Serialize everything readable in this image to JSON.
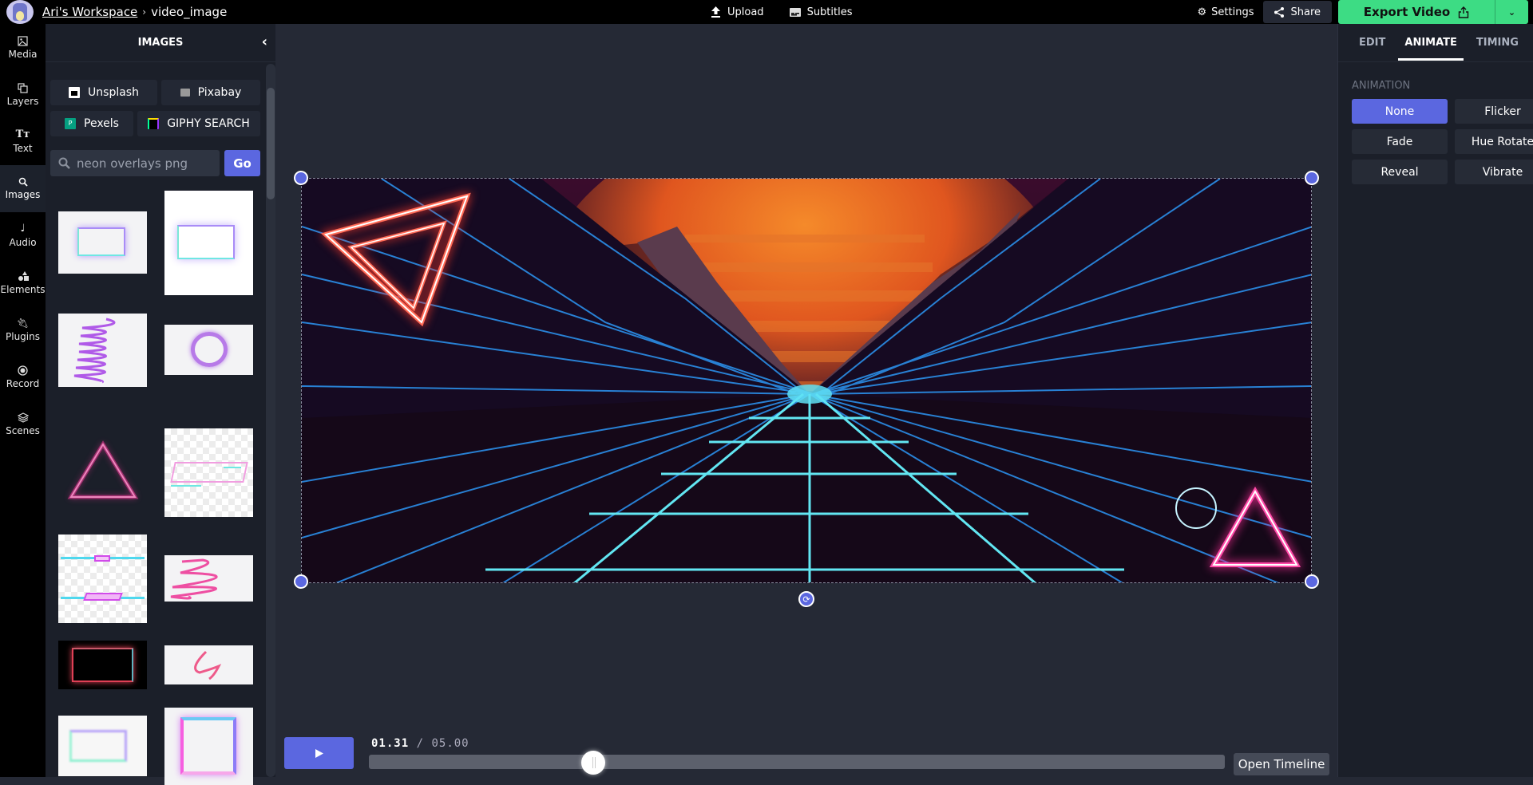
{
  "header": {
    "workspace": "Ari's Workspace",
    "separator": "›",
    "project": "video_image",
    "upload_label": "Upload",
    "subtitles_label": "Subtitles",
    "settings_label": "Settings",
    "share_label": "Share",
    "export_label": "Export Video"
  },
  "leftnav": {
    "items": [
      {
        "label": "Media",
        "icon": "image-icon"
      },
      {
        "label": "Layers",
        "icon": "layers-icon"
      },
      {
        "label": "Text",
        "icon": "text-icon"
      },
      {
        "label": "Images",
        "icon": "search-icon",
        "active": true
      },
      {
        "label": "Audio",
        "icon": "music-note-icon"
      },
      {
        "label": "Elements",
        "icon": "shapes-icon"
      },
      {
        "label": "Plugins",
        "icon": "plug-icon"
      },
      {
        "label": "Record",
        "icon": "record-icon"
      },
      {
        "label": "Scenes",
        "icon": "stack-icon"
      }
    ]
  },
  "images_panel": {
    "title": "IMAGES",
    "sources": [
      "Unsplash",
      "Pixabay",
      "Pexels",
      "GIPHY SEARCH"
    ],
    "search_value": "neon overlays png",
    "go_label": "Go",
    "results": [
      "neon gradient rectangle frame",
      "neon gradient rectangle frame tall",
      "purple neon spiral",
      "purple neon circle",
      "pink neon triangle",
      "pink neon parallelogram frame",
      "cyan pink game name overlay",
      "pink neon scribble",
      "red neon rectangle on black",
      "pink neon squiggle",
      "soft gradient rectangle frame",
      "glitch neon square frame"
    ]
  },
  "player": {
    "current_time": "01.31",
    "separator": "/",
    "total_time": "05.00",
    "progress": 0.262,
    "open_timeline_label": "Open Timeline"
  },
  "right_panel": {
    "tabs": [
      "EDIT",
      "ANIMATE",
      "TIMING"
    ],
    "active_tab": "ANIMATE",
    "section_label": "ANIMATION",
    "animations": [
      "None",
      "Flicker",
      "Fade",
      "Hue Rotate",
      "Reveal",
      "Vibrate"
    ],
    "selected": "None"
  },
  "colors": {
    "accent": "#5b67e0",
    "export": "#3ddc84"
  }
}
